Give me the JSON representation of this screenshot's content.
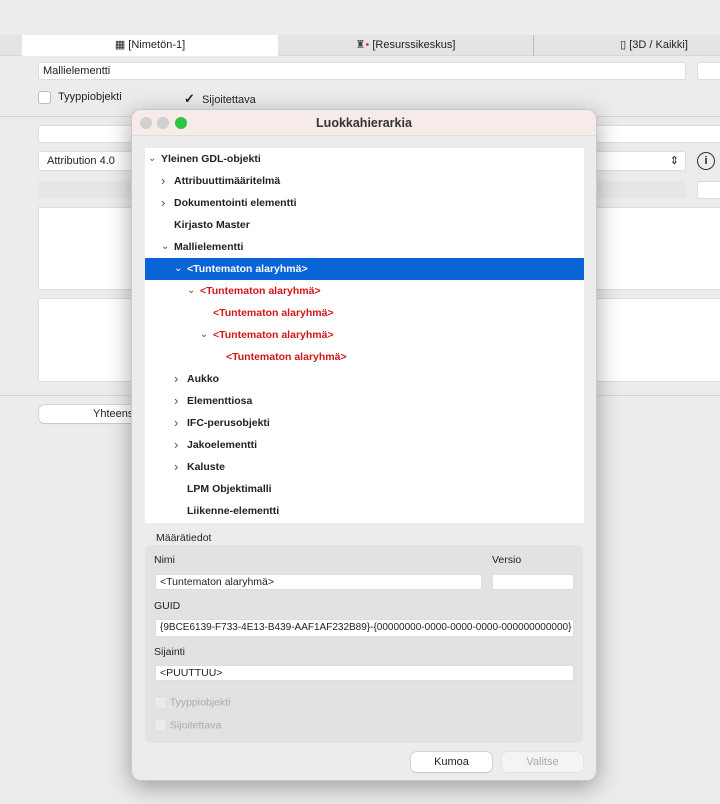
{
  "tabs": [
    {
      "label": "[Nimetön-1]",
      "icon": "floorplan-icon"
    },
    {
      "label": "[Resurssikeskus]",
      "icon": "lighthouse-icon"
    },
    {
      "label": "[3D / Kaikki]",
      "icon": "3d-box-icon"
    }
  ],
  "background": {
    "name_field": "Mallielementti",
    "typpiobjekti_label": "Tyyppiobjekti",
    "typpiobjekti_checked": false,
    "sijoitettava_label": "Sijoitettava",
    "sijoitettava_checked": true,
    "license_select": "Attribution 4.0",
    "yhteensa_button": "Yhteens"
  },
  "dialog": {
    "title": "Luokkahierarkia",
    "tree": [
      {
        "label": "Yleinen GDL-objekti",
        "level": 0,
        "state": "expanded"
      },
      {
        "label": "Attribuuttimääritelmä",
        "level": 1,
        "state": "collapsed"
      },
      {
        "label": "Dokumentointi elementti",
        "level": 1,
        "state": "collapsed"
      },
      {
        "label": "Kirjasto Master",
        "level": 1,
        "state": "leaf"
      },
      {
        "label": "Mallielementti",
        "level": 1,
        "state": "expanded"
      },
      {
        "label": "<Tuntematon alaryhmä>",
        "level": 2,
        "state": "expanded",
        "selected": true,
        "unknown": true
      },
      {
        "label": "<Tuntematon alaryhmä>",
        "level": 3,
        "state": "expanded",
        "unknown": true
      },
      {
        "label": "<Tuntematon alaryhmä>",
        "level": 4,
        "state": "leaf",
        "unknown": true
      },
      {
        "label": "<Tuntematon alaryhmä>",
        "level": 4,
        "state": "expanded",
        "unknown": true
      },
      {
        "label": "<Tuntematon alaryhmä>",
        "level": 5,
        "state": "leaf",
        "unknown": true
      },
      {
        "label": "Aukko",
        "level": 2,
        "state": "collapsed"
      },
      {
        "label": "Elementtiosa",
        "level": 2,
        "state": "collapsed"
      },
      {
        "label": "IFC-perusobjekti",
        "level": 2,
        "state": "collapsed"
      },
      {
        "label": "Jakoelementti",
        "level": 2,
        "state": "collapsed"
      },
      {
        "label": "Kaluste",
        "level": 2,
        "state": "collapsed"
      },
      {
        "label": "LPM Objektimalli",
        "level": 2,
        "state": "leaf"
      },
      {
        "label": "Liikenne-elementti",
        "level": 2,
        "state": "leaf"
      }
    ],
    "details": {
      "heading": "Määrätiedot",
      "name_label": "Nimi",
      "name_value": "<Tuntematon alaryhmä>",
      "version_label": "Versio",
      "version_value": "",
      "guid_label": "GUID",
      "guid_value": "{9BCE6139-F733-4E13-B439-AAF1AF232B89}-{00000000-0000-0000-0000-000000000000}",
      "location_label": "Sijainti",
      "location_value": "<PUUTTUU>",
      "typpiobjekti_label": "Tyyppiobjekti",
      "sijoitettava_label": "Sijoitettava"
    },
    "buttons": {
      "cancel": "Kumoa",
      "select": "Valitse"
    },
    "colors": {
      "selection": "#0964d8",
      "unknown_text": "#d0161b"
    }
  }
}
